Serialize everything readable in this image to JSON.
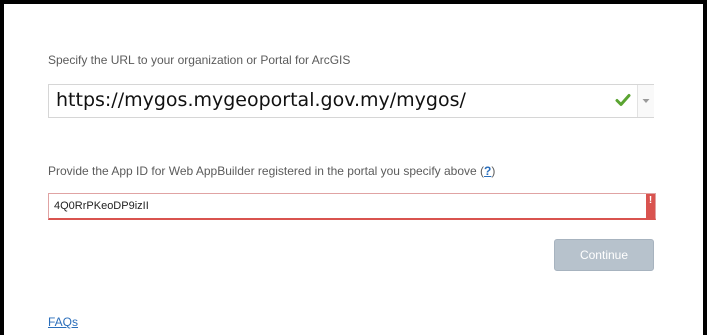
{
  "portal": {
    "label": "Specify the URL to your organization or Portal for ArcGIS",
    "url_value": "https://mygos.mygeoportal.gov.my/mygos/",
    "status_icon": "check-icon",
    "status_color": "#5aa431",
    "dropdown_icon": "chevron-down-icon"
  },
  "app_id": {
    "label_prefix": "Provide the App ID for Web AppBuilder registered in the portal you specify above (",
    "help_link": "?",
    "label_suffix": ")",
    "value": "4Q0RrPKeoDP9izII",
    "error_marker": "!",
    "error_color": "#d9534f"
  },
  "actions": {
    "continue_label": "Continue"
  },
  "footer": {
    "faq_label": "FAQs"
  }
}
